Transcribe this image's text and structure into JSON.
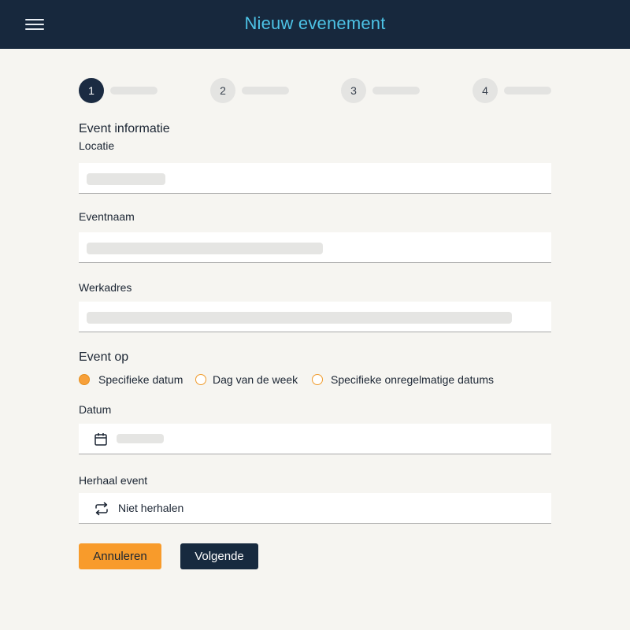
{
  "header": {
    "title": "Nieuw evenement",
    "menu_icon": "hamburger-menu-icon"
  },
  "stepper": {
    "steps": [
      {
        "number": "1",
        "active": true
      },
      {
        "number": "2",
        "active": false
      },
      {
        "number": "3",
        "active": false
      },
      {
        "number": "4",
        "active": false
      }
    ]
  },
  "form": {
    "section_event_info": "Event informatie",
    "location": {
      "label": "Locatie"
    },
    "event_name": {
      "label": "Eventnaam"
    },
    "work_address": {
      "label": "Werkadres"
    },
    "section_event_on": "Event op",
    "schedule_options": [
      {
        "label": "Specifieke datum",
        "checked": true
      },
      {
        "label": "Dag van de week",
        "checked": false
      },
      {
        "label": "Specifieke onregelmatige datums",
        "checked": false
      }
    ],
    "date": {
      "label": "Datum",
      "icon": "calendar-icon"
    },
    "repeat": {
      "label": "Herhaal event",
      "value": "Niet herhalen",
      "icon": "repeat-icon"
    }
  },
  "actions": {
    "cancel_label": "Annuleren",
    "next_label": "Volgende"
  },
  "colors": {
    "header_bg": "#17283d",
    "title": "#4dc3e6",
    "accent_orange": "#f89b2b",
    "primary_dark": "#172a3f",
    "background": "#f6f5f1"
  }
}
